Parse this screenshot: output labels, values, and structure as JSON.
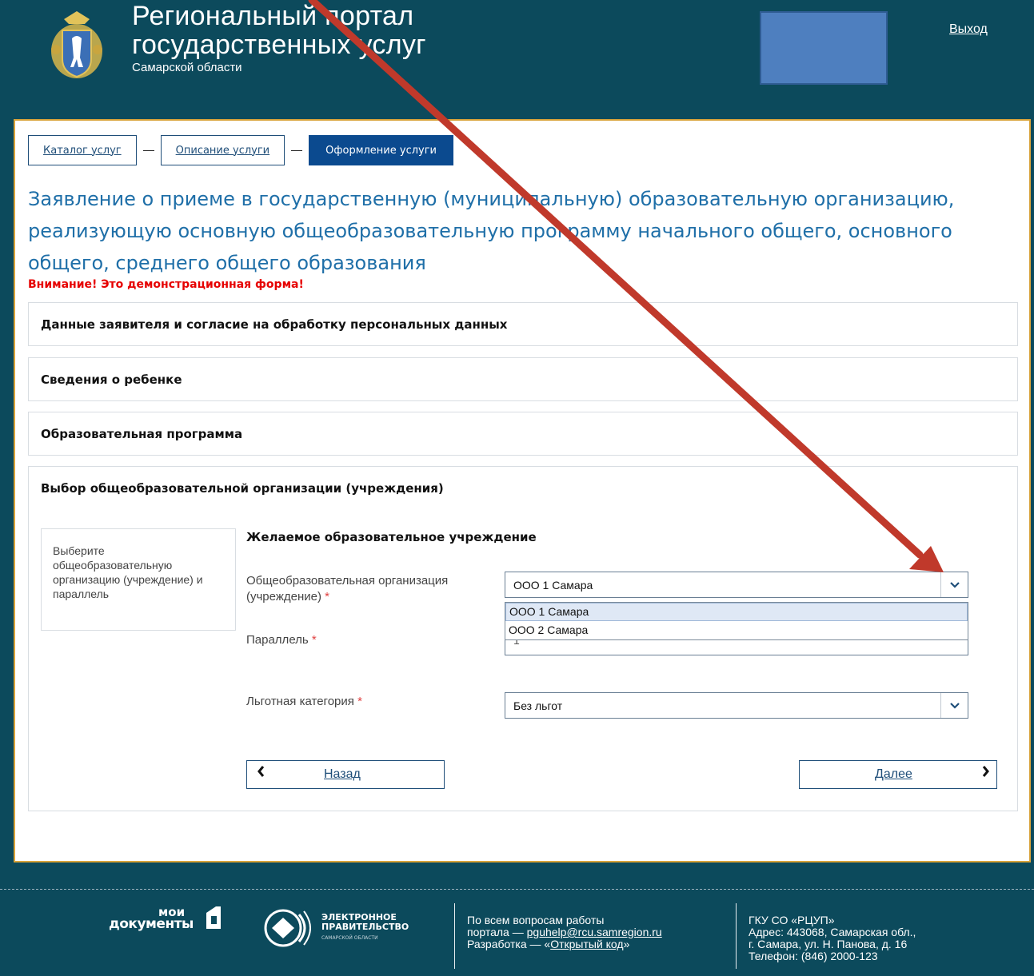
{
  "header": {
    "title_line1": "Региональный портал",
    "title_line2": "государственных услуг",
    "title_line3": "Самарской области",
    "logout": "Выход"
  },
  "breadcrumb": {
    "items": [
      "Каталог услуг",
      "Описание услуги",
      "Оформление услуги"
    ]
  },
  "page_title": "Заявление о приеме в государственную (муниципальную) образовательную организацию, реализующую основную общеобразовательную программу начального общего, основного общего, среднего общего образования",
  "warning": "Внимание! Это демонстрационная форма!",
  "sections": {
    "applicant": "Данные заявителя и согласие на обработку персональных данных",
    "child": "Сведения о ребенке",
    "program": "Образовательная программа",
    "school": "Выбор общеобразовательной организации (учреждения)"
  },
  "form": {
    "hint": "Выберите общеобразовательную организацию (учреждение) и параллель",
    "subheading": "Желаемое образовательное учреждение",
    "org_label": "Общеобразовательная организация (учреждение)",
    "org_value": "ООО 1 Самара",
    "org_options": [
      "ООО 1 Самара",
      "ООО 2 Самара"
    ],
    "grade_label": "Параллель",
    "grade_value": "1",
    "benefit_label": "Льготная категория",
    "benefit_value": "Без льгот",
    "required_mark": "*"
  },
  "buttons": {
    "back": "Назад",
    "next": "Далее"
  },
  "footer": {
    "moi_docs_line1": "мои",
    "moi_docs_line2": "документы",
    "egov_line1": "ЭЛЕКТРОННОЕ",
    "egov_line2": "ПРАВИТЕЛЬСТВО",
    "egov_sub": "САМАРСКОЙ ОБЛАСТИ",
    "support_line1": "По всем вопросам работы",
    "support_line2_prefix": "портала — ",
    "support_email": "pguhelp@rcu.samregion.ru",
    "support_line3_prefix": "Разработка — «",
    "support_dev": "Открытый код",
    "support_line3_suffix": "»",
    "org_name": "ГКУ СО «РЦУП»",
    "org_address1": "Адрес: 443068, Самарская обл.,",
    "org_address2": "г. Самара, ул. Н. Панова, д. 16",
    "org_phone": "Телефон: (846) 2000-123"
  },
  "colors": {
    "header_bg": "#0c4a5c",
    "accent": "#1f6fa8",
    "active_crumb": "#0b4a8f",
    "warning": "#e60000",
    "content_border": "#d9a33a",
    "annotation_arrow": "#c0392b"
  }
}
